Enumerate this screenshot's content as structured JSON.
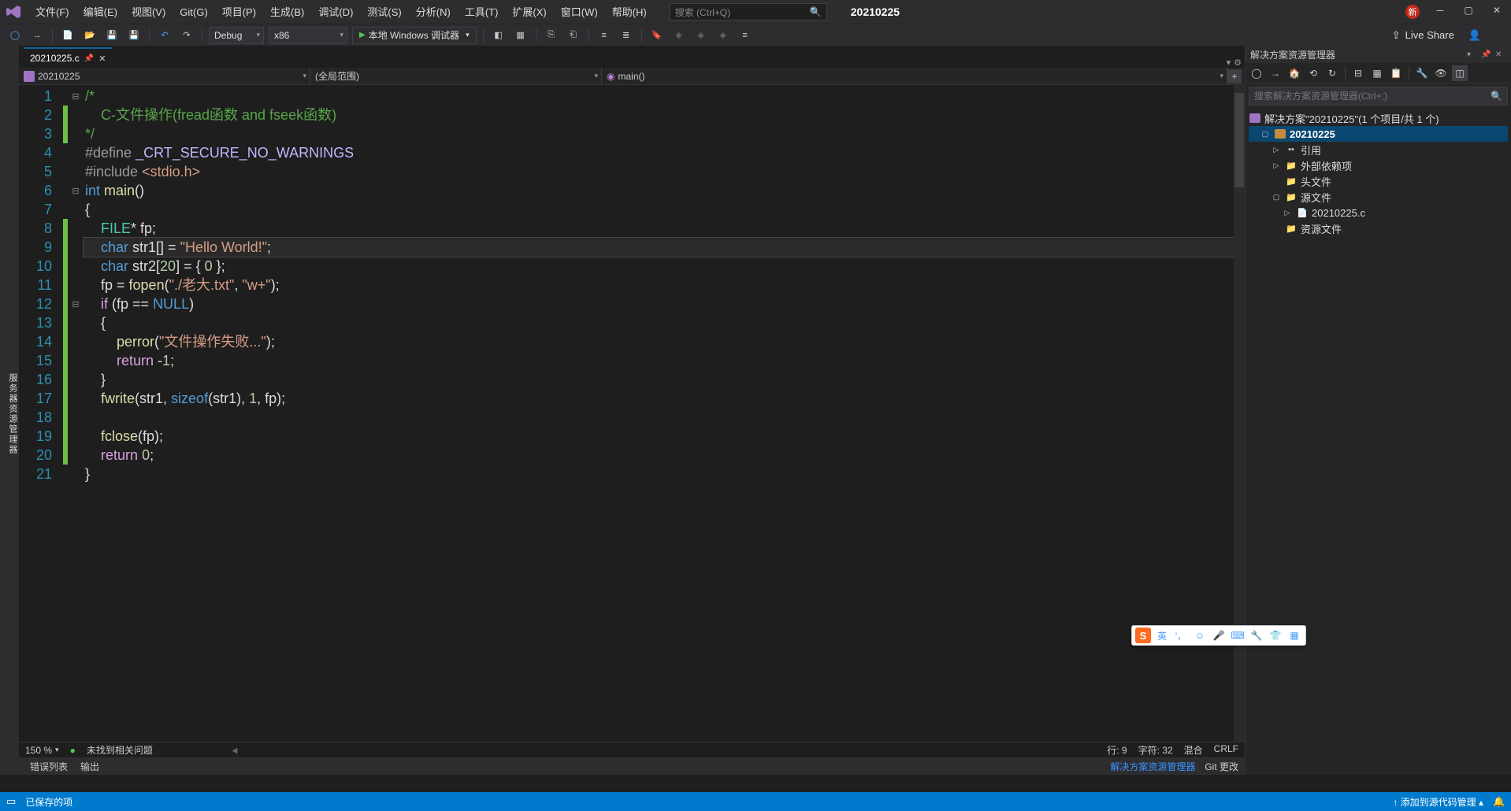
{
  "menubar": {
    "items": [
      "文件(F)",
      "编辑(E)",
      "视图(V)",
      "Git(G)",
      "项目(P)",
      "生成(B)",
      "调试(D)",
      "测试(S)",
      "分析(N)",
      "工具(T)",
      "扩展(X)",
      "窗口(W)",
      "帮助(H)"
    ],
    "search_placeholder": "搜索 (Ctrl+Q)",
    "project_name": "20210225",
    "badge": "新"
  },
  "toolbar": {
    "config": "Debug",
    "platform": "x86",
    "debugger_label": "本地 Windows 调试器",
    "liveshare": "Live Share"
  },
  "tab": {
    "filename": "20210225.c"
  },
  "breadcrumb": {
    "module": "20210225",
    "scope": "(全局范围)",
    "function": "main()"
  },
  "code": {
    "lines": [
      {
        "n": 1,
        "fold": "⊟",
        "mod": false,
        "seg": [
          {
            "t": "/*",
            "c": "c-comment"
          }
        ]
      },
      {
        "n": 2,
        "mod": true,
        "seg": [
          {
            "t": "    C-文件操作(fread函数 and fseek函数)",
            "c": "c-comment"
          }
        ]
      },
      {
        "n": 3,
        "mod": true,
        "seg": [
          {
            "t": "*/",
            "c": "c-comment"
          }
        ]
      },
      {
        "n": 4,
        "mod": false,
        "seg": [
          {
            "t": "#define ",
            "c": "c-pp"
          },
          {
            "t": "_CRT_SECURE_NO_WARNINGS",
            "c": "c-ppval"
          }
        ]
      },
      {
        "n": 5,
        "mod": false,
        "seg": [
          {
            "t": "#include ",
            "c": "c-pp"
          },
          {
            "t": "<stdio.h>",
            "c": "c-include"
          }
        ]
      },
      {
        "n": 6,
        "fold": "⊟",
        "mod": false,
        "seg": [
          {
            "t": "int",
            "c": "c-kw"
          },
          {
            "t": " ",
            "c": ""
          },
          {
            "t": "main",
            "c": "c-func"
          },
          {
            "t": "()",
            "c": "c-op"
          }
        ]
      },
      {
        "n": 7,
        "mod": false,
        "seg": [
          {
            "t": "{",
            "c": "c-op"
          }
        ]
      },
      {
        "n": 8,
        "mod": true,
        "seg": [
          {
            "t": "    ",
            "c": ""
          },
          {
            "t": "FILE",
            "c": "c-type"
          },
          {
            "t": "* fp;",
            "c": "c-op"
          }
        ]
      },
      {
        "n": 9,
        "mod": true,
        "current": true,
        "seg": [
          {
            "t": "    ",
            "c": ""
          },
          {
            "t": "char",
            "c": "c-kw"
          },
          {
            "t": " str1[] = ",
            "c": "c-op"
          },
          {
            "t": "\"Hello World!\"",
            "c": "c-str"
          },
          {
            "t": ";",
            "c": "c-op"
          }
        ]
      },
      {
        "n": 10,
        "mod": true,
        "seg": [
          {
            "t": "    ",
            "c": ""
          },
          {
            "t": "char",
            "c": "c-kw"
          },
          {
            "t": " str2[",
            "c": "c-op"
          },
          {
            "t": "20",
            "c": "c-num"
          },
          {
            "t": "] = { ",
            "c": "c-op"
          },
          {
            "t": "0",
            "c": "c-num"
          },
          {
            "t": " };",
            "c": "c-op"
          }
        ]
      },
      {
        "n": 11,
        "mod": true,
        "seg": [
          {
            "t": "    fp = ",
            "c": "c-op"
          },
          {
            "t": "fopen",
            "c": "c-func"
          },
          {
            "t": "(",
            "c": "c-op"
          },
          {
            "t": "\"./老大.txt\"",
            "c": "c-str"
          },
          {
            "t": ", ",
            "c": "c-op"
          },
          {
            "t": "\"w+\"",
            "c": "c-str"
          },
          {
            "t": ");",
            "c": "c-op"
          }
        ]
      },
      {
        "n": 12,
        "fold": "⊟",
        "mod": true,
        "seg": [
          {
            "t": "    ",
            "c": ""
          },
          {
            "t": "if",
            "c": "c-ret"
          },
          {
            "t": " (fp == ",
            "c": "c-op"
          },
          {
            "t": "NULL",
            "c": "c-kw"
          },
          {
            "t": ")",
            "c": "c-op"
          }
        ]
      },
      {
        "n": 13,
        "mod": true,
        "seg": [
          {
            "t": "    {",
            "c": "c-op"
          }
        ]
      },
      {
        "n": 14,
        "mod": true,
        "seg": [
          {
            "t": "        ",
            "c": ""
          },
          {
            "t": "perror",
            "c": "c-func"
          },
          {
            "t": "(",
            "c": "c-op"
          },
          {
            "t": "\"文件操作失败...\"",
            "c": "c-str"
          },
          {
            "t": ");",
            "c": "c-op"
          }
        ]
      },
      {
        "n": 15,
        "mod": true,
        "seg": [
          {
            "t": "        ",
            "c": ""
          },
          {
            "t": "return",
            "c": "c-ret"
          },
          {
            "t": " -",
            "c": "c-op"
          },
          {
            "t": "1",
            "c": "c-num"
          },
          {
            "t": ";",
            "c": "c-op"
          }
        ]
      },
      {
        "n": 16,
        "mod": true,
        "seg": [
          {
            "t": "    }",
            "c": "c-op"
          }
        ]
      },
      {
        "n": 17,
        "mod": true,
        "seg": [
          {
            "t": "    ",
            "c": ""
          },
          {
            "t": "fwrite",
            "c": "c-func"
          },
          {
            "t": "(str1, ",
            "c": "c-op"
          },
          {
            "t": "sizeof",
            "c": "c-kw"
          },
          {
            "t": "(str1), ",
            "c": "c-op"
          },
          {
            "t": "1",
            "c": "c-num"
          },
          {
            "t": ", fp);",
            "c": "c-op"
          }
        ]
      },
      {
        "n": 18,
        "mod": true,
        "seg": [
          {
            "t": " ",
            "c": ""
          }
        ]
      },
      {
        "n": 19,
        "mod": true,
        "seg": [
          {
            "t": "    ",
            "c": ""
          },
          {
            "t": "fclose",
            "c": "c-func"
          },
          {
            "t": "(fp);",
            "c": "c-op"
          }
        ]
      },
      {
        "n": 20,
        "mod": true,
        "seg": [
          {
            "t": "    ",
            "c": ""
          },
          {
            "t": "return",
            "c": "c-ret"
          },
          {
            "t": " ",
            "c": ""
          },
          {
            "t": "0",
            "c": "c-num"
          },
          {
            "t": ";",
            "c": "c-op"
          }
        ]
      },
      {
        "n": 21,
        "mod": false,
        "seg": [
          {
            "t": "}",
            "c": "c-op"
          }
        ]
      }
    ]
  },
  "editor_status": {
    "zoom": "150 %",
    "issues": "未找到相关问题",
    "line_label": "行:",
    "line": "9",
    "char_label": "字符:",
    "char": "32",
    "mixed": "混合",
    "eol": "CRLF"
  },
  "solution": {
    "title": "解决方案资源管理器",
    "search_placeholder": "搜索解决方案资源管理器(Ctrl+;)",
    "root": "解决方案\"20210225\"(1 个项目/共 1 个)",
    "project": "20210225",
    "nodes": {
      "refs": "引用",
      "ext": "外部依赖项",
      "headers": "头文件",
      "sources": "源文件",
      "srcfile": "20210225.c",
      "resources": "资源文件"
    }
  },
  "output_tabs": {
    "errorlist": "错误列表",
    "output": "输出",
    "sol_explorer": "解决方案资源管理器",
    "git_changes": "Git 更改"
  },
  "statusbar": {
    "saved": "已保存的项",
    "add_source": "添加到源代码管理"
  },
  "ime": {
    "lang": "英"
  }
}
